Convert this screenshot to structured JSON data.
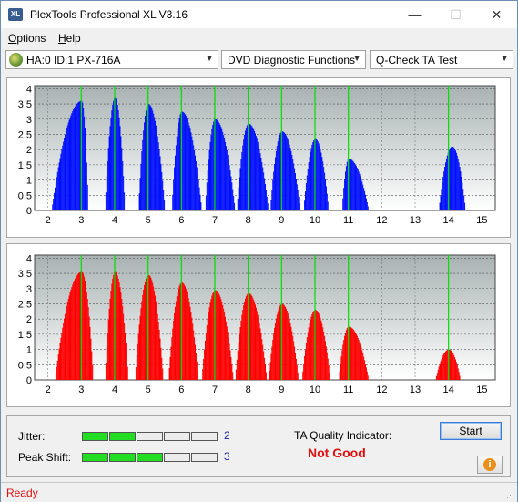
{
  "window": {
    "title": "PlexTools Professional XL V3.16",
    "icon_label": "XL",
    "controls": {
      "minimize": "—",
      "maximize": "☐",
      "close": "✕"
    }
  },
  "menu": [
    {
      "label_u": "O",
      "label_rest": "ptions"
    },
    {
      "label_u": "H",
      "label_rest": "elp"
    }
  ],
  "toolbar": {
    "drive": "HA:0 ID:1  PX-716A",
    "function": "DVD Diagnostic Functions",
    "test": "Q-Check TA Test"
  },
  "colors": {
    "jitter_series": "#0010ff",
    "peakshift_series": "#ff0000",
    "plot_bg": "#ffffff",
    "marker_line": "#00e000",
    "meter_on": "#22dd22",
    "meter_off": "#ececec"
  },
  "chart_data": [
    {
      "type": "bar",
      "name": "Jitter TA chart",
      "x_ticks": [
        "2",
        "3",
        "4",
        "5",
        "6",
        "7",
        "8",
        "9",
        "10",
        "11",
        "12",
        "13",
        "14",
        "15"
      ],
      "y_ticks": [
        "0",
        "0.5",
        "1",
        "1.5",
        "2",
        "2.5",
        "3",
        "3.5",
        "4"
      ],
      "xlim": [
        1.6,
        15.4
      ],
      "ylim": [
        0,
        4.1
      ],
      "marker_positions": [
        3,
        4,
        5,
        6,
        7,
        8,
        9,
        10,
        11,
        14
      ],
      "series": [
        {
          "name": "",
          "peaks": [
            {
              "x": 3,
              "height": 3.6,
              "left": 0.9,
              "right": 0.2
            },
            {
              "x": 4,
              "height": 3.7,
              "left": 0.3,
              "right": 0.3
            },
            {
              "x": 5,
              "height": 3.5,
              "left": 0.3,
              "right": 0.5
            },
            {
              "x": 6,
              "height": 3.25,
              "left": 0.3,
              "right": 0.6
            },
            {
              "x": 7,
              "height": 3.0,
              "left": 0.3,
              "right": 0.6
            },
            {
              "x": 8,
              "height": 2.85,
              "left": 0.35,
              "right": 0.6
            },
            {
              "x": 9,
              "height": 2.6,
              "left": 0.35,
              "right": 0.55
            },
            {
              "x": 10,
              "height": 2.35,
              "left": 0.35,
              "right": 0.4
            },
            {
              "x": 11,
              "height": 1.7,
              "left": 0.2,
              "right": 0.6
            },
            {
              "x": 14.1,
              "height": 2.1,
              "left": 0.4,
              "right": 0.4
            }
          ]
        }
      ]
    },
    {
      "type": "bar",
      "name": "Peak Shift TA chart",
      "x_ticks": [
        "2",
        "3",
        "4",
        "5",
        "6",
        "7",
        "8",
        "9",
        "10",
        "11",
        "12",
        "13",
        "14",
        "15"
      ],
      "y_ticks": [
        "0",
        "0.5",
        "1",
        "1.5",
        "2",
        "2.5",
        "3",
        "3.5",
        "4"
      ],
      "xlim": [
        1.6,
        15.4
      ],
      "ylim": [
        0,
        4.1
      ],
      "marker_positions": [
        3,
        4,
        5,
        6,
        7,
        8,
        9,
        10,
        11,
        14
      ],
      "series": [
        {
          "name": "",
          "peaks": [
            {
              "x": 3,
              "height": 3.55,
              "left": 0.8,
              "right": 0.35
            },
            {
              "x": 4,
              "height": 3.55,
              "left": 0.3,
              "right": 0.4
            },
            {
              "x": 5,
              "height": 3.45,
              "left": 0.4,
              "right": 0.45
            },
            {
              "x": 6,
              "height": 3.2,
              "left": 0.4,
              "right": 0.5
            },
            {
              "x": 7,
              "height": 2.95,
              "left": 0.4,
              "right": 0.55
            },
            {
              "x": 8,
              "height": 2.85,
              "left": 0.4,
              "right": 0.55
            },
            {
              "x": 9,
              "height": 2.5,
              "left": 0.4,
              "right": 0.5
            },
            {
              "x": 10,
              "height": 2.3,
              "left": 0.4,
              "right": 0.45
            },
            {
              "x": 11,
              "height": 1.75,
              "left": 0.3,
              "right": 0.6
            },
            {
              "x": 14,
              "height": 1.0,
              "left": 0.4,
              "right": 0.35
            }
          ]
        }
      ]
    }
  ],
  "metrics": {
    "jitter": {
      "label": "Jitter:",
      "value": "2",
      "score": 2,
      "max": 5
    },
    "peak_shift": {
      "label": "Peak Shift:",
      "value": "3",
      "score": 3,
      "max": 5
    }
  },
  "ta_quality": {
    "label": "TA Quality Indicator:",
    "value": "Not Good"
  },
  "buttons": {
    "start": "Start",
    "info": "i"
  },
  "status": {
    "text": "Ready"
  }
}
